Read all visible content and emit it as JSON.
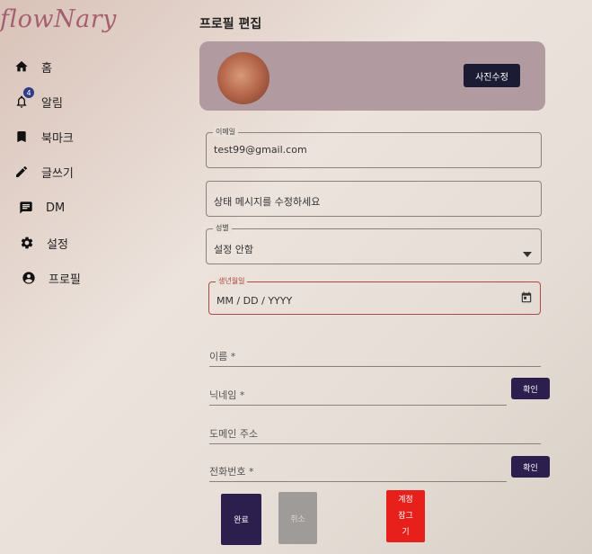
{
  "logo": "flowNary",
  "nav": {
    "items": [
      {
        "label": "홈",
        "icon": "home-icon"
      },
      {
        "label": "알림",
        "icon": "bell-icon",
        "badge": "4"
      },
      {
        "label": "북마크",
        "icon": "bookmark-icon"
      },
      {
        "label": "글쓰기",
        "icon": "pencil-icon"
      },
      {
        "label": "DM",
        "icon": "message-icon"
      },
      {
        "label": "설정",
        "icon": "gear-icon"
      },
      {
        "label": "프로필",
        "icon": "account-circle-icon"
      }
    ]
  },
  "page": {
    "title": "프로필 편집"
  },
  "profile": {
    "photo_button": "사진수정"
  },
  "form": {
    "email": {
      "label": "이메일",
      "value": "test99@gmail.com"
    },
    "status": {
      "placeholder": "상태 메시지를 수정하세요"
    },
    "gender": {
      "label": "성별",
      "value": "설정 안함"
    },
    "birthdate": {
      "label": "생년월일",
      "placeholder": "MM / DD / YYYY"
    },
    "name": {
      "label": "이름 *"
    },
    "nickname": {
      "label": "닉네임 *",
      "button": "확인"
    },
    "domain": {
      "label": "도메인 주소"
    },
    "phone": {
      "label": "전화번호 *",
      "button": "확인"
    }
  },
  "actions": {
    "done": "완료",
    "cancel": "취소",
    "lock_account": [
      "계정",
      "잠그",
      "기"
    ]
  },
  "colors": {
    "accent": "#2c1e4d",
    "lock": "#e8201c",
    "error_border": "#b04848"
  }
}
